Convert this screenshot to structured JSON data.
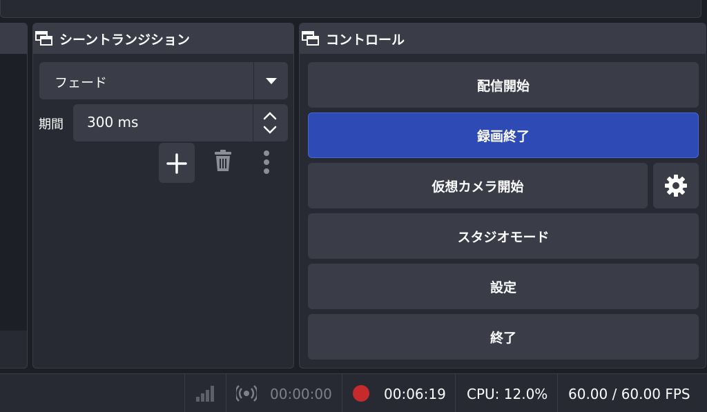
{
  "transitions_dock": {
    "title": "シーントランジション",
    "transition_type": "フェード",
    "duration_label": "期間",
    "duration_value": "300 ms"
  },
  "controls_dock": {
    "title": "コントロール",
    "start_streaming": "配信開始",
    "stop_recording": "録画終了",
    "start_virtual_camera": "仮想カメラ開始",
    "studio_mode": "スタジオモード",
    "settings": "設定",
    "exit": "終了"
  },
  "status_bar": {
    "stream_time": "00:00:00",
    "record_time": "00:06:19",
    "cpu": "CPU: 12.0%",
    "fps": "60.00 / 60.00 FPS"
  },
  "colors": {
    "active_button": "#2e4ab5",
    "record_dot": "#c62a2a",
    "panel": "#272a33",
    "header": "#3a3d48"
  },
  "icons": [
    "dock-window-icon",
    "chevron-down-icon",
    "chevron-up-icon",
    "plus-icon",
    "trash-icon",
    "more-vertical-icon",
    "gear-icon",
    "signal-bars-icon",
    "broadcast-icon",
    "record-icon"
  ]
}
